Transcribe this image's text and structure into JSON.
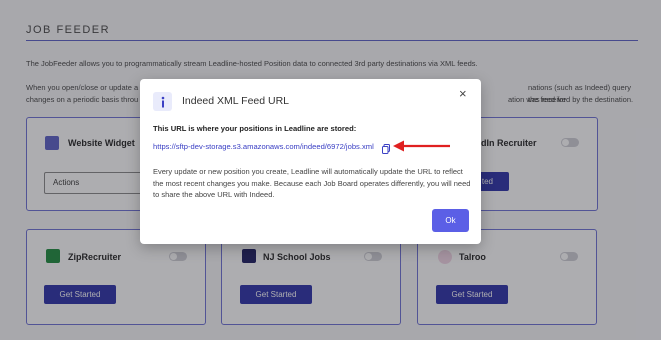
{
  "page": {
    "title": "JOB FEEDER",
    "intro": "The JobFeeder allows you to programmatically stream Leadline-hosted Position data to connected 3rd party destinations via XML feeds.",
    "intro2_left": "When you open/close or update a",
    "intro2_right": "nations (such as Indeed) query the feed for",
    "intro3_left": "changes on a periodic basis throu",
    "intro3_right": "ation was received by the destination."
  },
  "cards": {
    "website_widget": {
      "title": "Website Widget",
      "select_value": "Actions"
    },
    "linkedin": {
      "title_partial": "dIn Recruiter",
      "button_partial": "ted"
    },
    "ziprecruiter": {
      "title": "ZipRecruiter",
      "button": "Get Started"
    },
    "nj_school_jobs": {
      "title": "NJ School Jobs",
      "button": "Get Started"
    },
    "talroo": {
      "title": "Talroo",
      "button": "Get Started"
    }
  },
  "modal": {
    "title": "Indeed XML Feed URL",
    "subhead": "This URL is where your positions in Leadline are stored:",
    "url": "https://sftp-dev-storage.s3.amazonaws.com/indeed/6972/jobs.xml",
    "body": "Every update or new position you create, Leadline will automatically update the URL to reflect the most recent changes you make. Because each Job Board operates differently, you will need to share the above URL with Indeed.",
    "ok_label": "Ok",
    "close_label": "×"
  },
  "colors": {
    "accent": "#5b5fe6",
    "button_dark": "#2b2fa8",
    "link": "#3b40c4",
    "arrow": "#e02020"
  },
  "icons": [
    "info-icon",
    "close-icon",
    "copy-icon",
    "red-arrow-icon"
  ]
}
